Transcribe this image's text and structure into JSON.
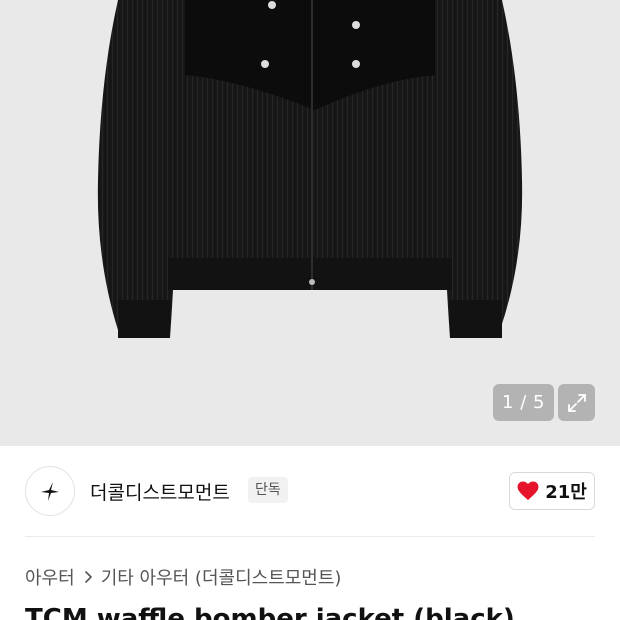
{
  "gallery": {
    "image_alt": "TCM waffle bomber jacket (black)",
    "current": "1 / 5",
    "expand_icon": "expand-icon"
  },
  "brand": {
    "name": "더콜디스트모먼트",
    "badge": "단독",
    "logo_icon": "brand-logo-icon"
  },
  "like": {
    "icon": "heart-icon",
    "count": "21만",
    "color": "#e5132b"
  },
  "breadcrumb": {
    "items": [
      "아우터",
      "기타 아우터 (더콜디스트모먼트)"
    ],
    "separator_icon": "chevron-right-icon"
  },
  "product": {
    "title": "TCM waffle bomber jacket (black)"
  }
}
